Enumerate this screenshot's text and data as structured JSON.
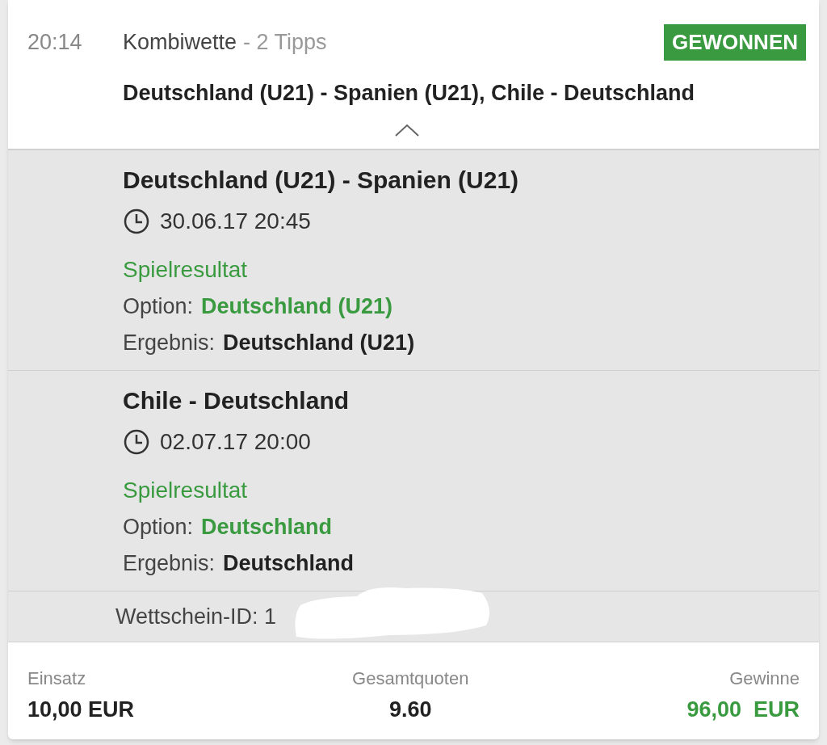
{
  "bet": {
    "time": "20:14",
    "type": "Kombiwette",
    "tips": "- 2 Tipps",
    "won": true,
    "status_label": "GEWONNEN",
    "matches": "Deutschland (U21) - Spanien (U21), Chile - Deutschland",
    "expanded": true
  },
  "legs": [
    {
      "title": "Deutschland (U21) - Spanien (U21)",
      "datetime": "30.06.17 20:45",
      "market": "Spielresultat",
      "option_label": "Option:",
      "option": "Deutschland (U21)",
      "result_label": "Ergebnis:",
      "result": "Deutschland (U21)"
    },
    {
      "title": "Chile - Deutschland",
      "datetime": "02.07.17 20:00",
      "market": "Spielresultat",
      "option_label": "Option:",
      "option": "Deutschland",
      "result_label": "Ergebnis:",
      "result": "Deutschland"
    }
  ],
  "slip_id": {
    "text": "Wettschein-ID: 1",
    "redacted": true
  },
  "footer": {
    "stake_label": "Einsatz",
    "stake": "10,00 EUR",
    "odds_label": "Gesamtquoten",
    "odds": "9.60",
    "winnings_label": "Gewinne",
    "winnings": "96,00  EUR"
  }
}
